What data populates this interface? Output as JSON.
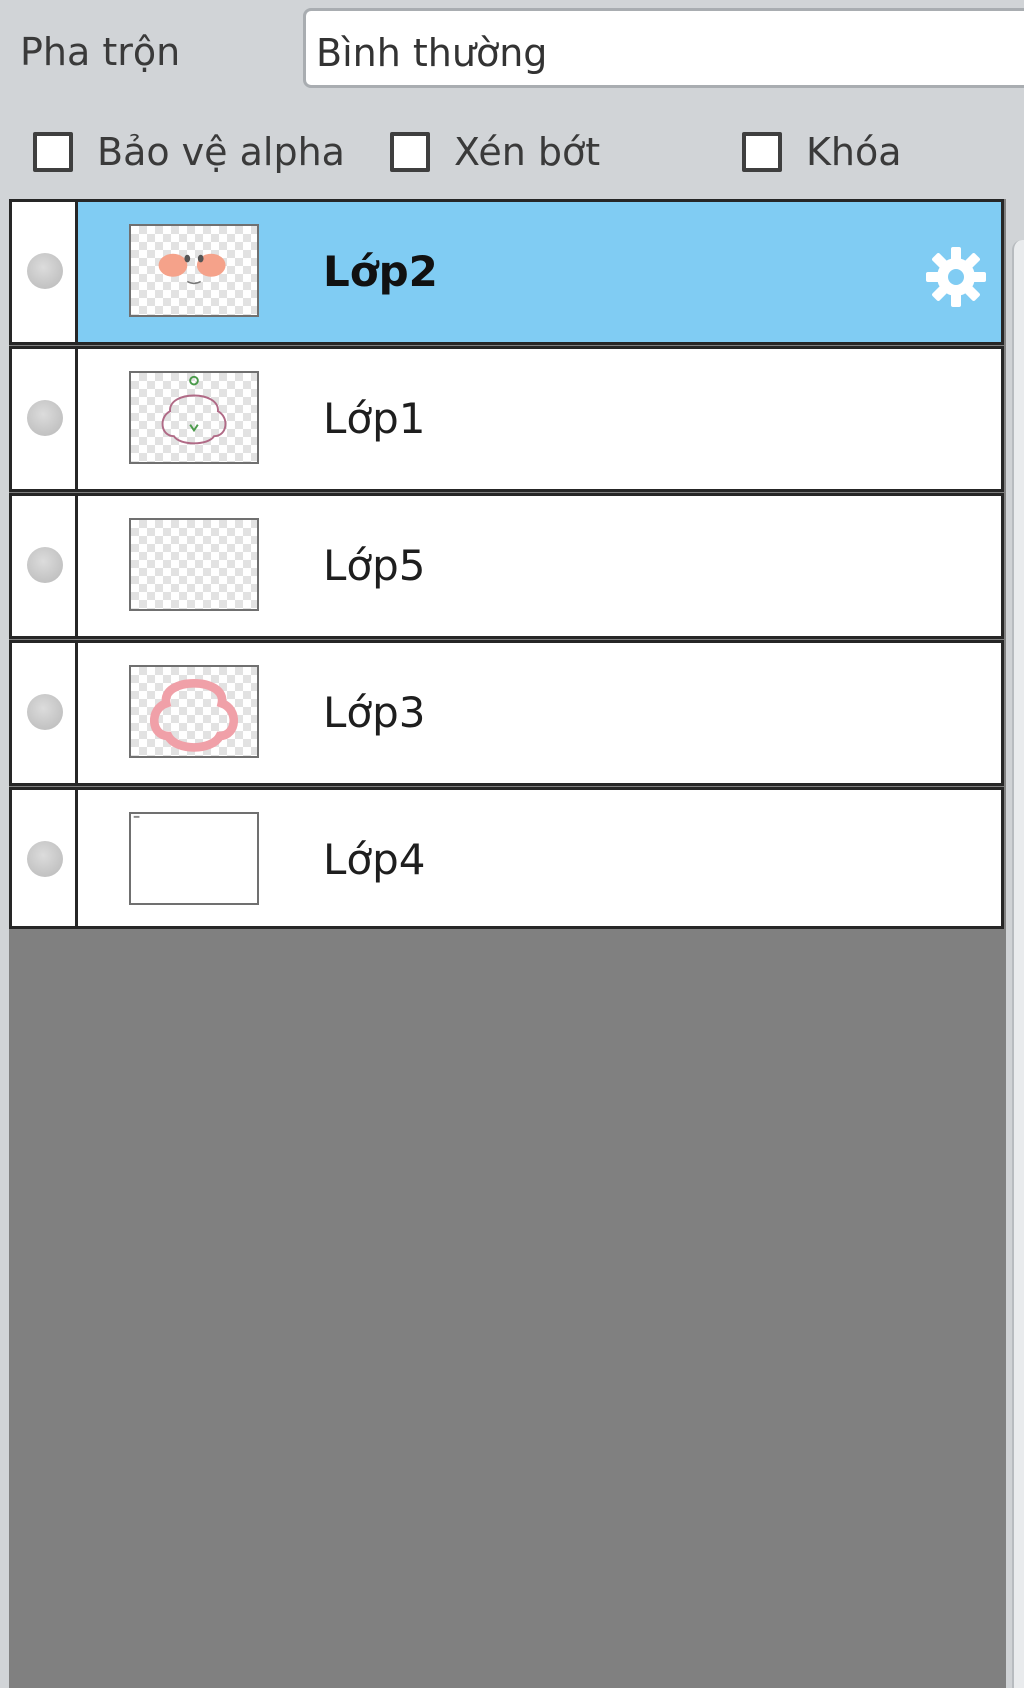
{
  "blend": {
    "label": "Pha trộn",
    "value": "Bình thường"
  },
  "options": [
    {
      "label": "Bảo vệ alpha",
      "checked": false
    },
    {
      "label": "Xén bớt",
      "checked": false
    },
    {
      "label": "Khóa",
      "checked": false
    }
  ],
  "layers": [
    {
      "name": "Lớp2",
      "selected": true,
      "thumbnail": "peach-marks-on-transparent",
      "has_settings": true
    },
    {
      "name": "Lớp1",
      "selected": false,
      "thumbnail": "outline-sketch-on-transparent"
    },
    {
      "name": "Lớp5",
      "selected": false,
      "thumbnail": "empty-transparent"
    },
    {
      "name": "Lớp3",
      "selected": false,
      "thumbnail": "pink-ring-on-transparent"
    },
    {
      "name": "Lớp4",
      "selected": false,
      "thumbnail": "white-fill"
    }
  ],
  "icons": {
    "settings": "gear-icon",
    "visibility": "visibility-dot-icon",
    "dropdown": "chevron-down-icon"
  },
  "colors": {
    "selected_row": "#80ccf3",
    "list_background": "#808080",
    "panel_background": "#d1d4d7"
  }
}
